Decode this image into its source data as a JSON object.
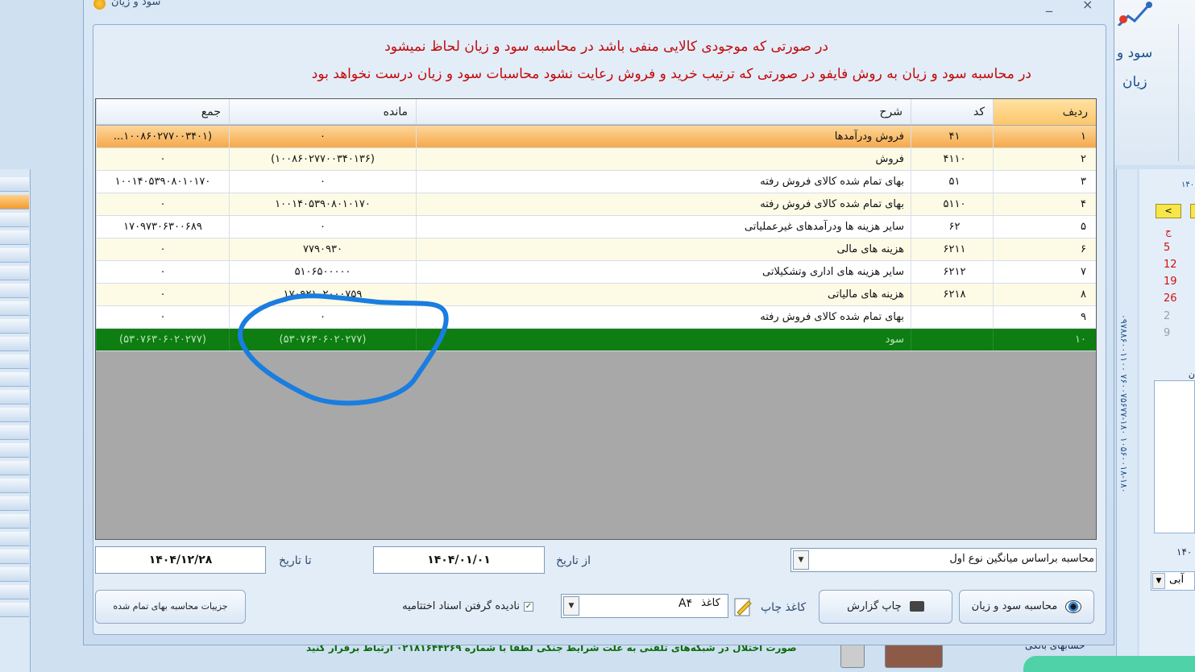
{
  "window": {
    "title": "سود و زیان",
    "minimize": "_",
    "close": "×"
  },
  "notices": [
    "در صورتی که موجودی کالایی منفی باشد در محاسبه سود و زیان لحاظ نمیشود",
    "در محاسبه سود و زیان به روش فایفو در صورتی که ترتیب خرید و فروش رعایت نشود محاسبات سود و زیان درست نخواهد بود"
  ],
  "grid": {
    "columns": [
      "ردیف",
      "کد",
      "شرح",
      "مانده",
      "جمع"
    ],
    "rows": [
      {
        "radif": "۱",
        "kod": "۴۱",
        "sharh": "فروش ودرآمدها",
        "mande": "۰",
        "jam": "(۱۰۰۸۶۰۲۷۷۰۰۳۴۰۱..."
      },
      {
        "radif": "۲",
        "kod": "۴۱۱۰",
        "sharh": "فروش",
        "mande": "(۱۰۰۸۶۰۲۷۷۰۰۳۴۰۱۳۶)",
        "jam": "۰"
      },
      {
        "radif": "۳",
        "kod": "۵۱",
        "sharh": "بهای تمام شده کالای فروش رفته",
        "mande": "۰",
        "jam": "۱۰۰۱۴۰۵۳۹۰۸۰۱۰۱۷۰"
      },
      {
        "radif": "۴",
        "kod": "۵۱۱۰",
        "sharh": "بهای تمام شده کالای فروش رفته",
        "mande": "۱۰۰۱۴۰۵۳۹۰۸۰۱۰۱۷۰",
        "jam": "۰"
      },
      {
        "radif": "۵",
        "kod": "۶۲",
        "sharh": "سایر هزینه ها ودرآمدهای غیرعملیاتی",
        "mande": "۰",
        "jam": "۱۷۰۹۷۳۰۶۳۰۰۶۸۹"
      },
      {
        "radif": "۶",
        "kod": "۶۲۱۱",
        "sharh": "هزینه های مالی",
        "mande": "۷۷۹۰۹۳۰",
        "jam": "۰"
      },
      {
        "radif": "۷",
        "kod": "۶۲۱۲",
        "sharh": "سایر هزینه های اداری وتشکیلاتی",
        "mande": "۵۱۰۶۵۰۰۰۰۰",
        "jam": "۰"
      },
      {
        "radif": "۸",
        "kod": "۶۲۱۸",
        "sharh": "هزینه های مالیاتی",
        "mande": "۱۷۰۹۲۱۰۲۰۰۰۷۵۹",
        "jam": "۰"
      },
      {
        "radif": "۹",
        "kod": "",
        "sharh": "بهای تمام شده کالای فروش رفته",
        "mande": "۰",
        "jam": "۰"
      },
      {
        "radif": "۱۰",
        "kod": "",
        "sharh": "سود",
        "mande": "(۵۳۰۷۶۳۰۶۰۲۰۲۷۷)",
        "jam": "(۵۳۰۷۶۳۰۶۰۲۰۲۷۷)"
      }
    ]
  },
  "filters": {
    "to_date_label": "تا تاریخ",
    "to_date": "۱۴۰۴/۱۲/۲۸",
    "from_date_label": "از تاریخ",
    "from_date": "۱۴۰۴/۰۱/۰۱",
    "method": "محاسبه براساس میانگین نوع اول"
  },
  "actions": {
    "details_button": "جزییات محاسبه بهای تمام شده",
    "ignore_closing_label": "نادیده گرفتن اسناد اختتامیه",
    "ignore_closing_checked": "✓",
    "paper_value": "A۴",
    "paper_label_1": "کاغذ",
    "paper_label_2": "کاغذ چاپ",
    "print_button": "چاپ گزارش",
    "calc_button": "محاسبه سود و زیان"
  },
  "background": {
    "ribbon_label_1": "سود و",
    "ribbon_label_2": "زیان",
    "vertical_phone": "۰۹۷۸۸۶۰۰۱۱۰۰ ۷۶۰۰۷۵۶۷۷-۱۸۰ ۱۰۵۶۰۰۱۸-۱۸۰",
    "calendar_year": "۱۴۰",
    "calendar_prev": "<",
    "calendar_header": "ج",
    "calendar_days": [
      "5",
      "12",
      "19",
      "26",
      "2",
      "9"
    ],
    "calendar_south": "ن جنوب",
    "calendar_year2": "۱۴۰",
    "color_combo": "آبی",
    "status_message": "صورت اختلال در شبکه‌های تلفنی به علت شرایط جنگی لطفا با شماره ۰۲۱۸۱۶۴۴۲۶۹ ارتباط برقرار کنید",
    "bank_label": "حسابهای بانکی"
  },
  "colors": {
    "notice": "#c30909",
    "total_row": "#0e7d12",
    "selected_row": "#f6a84a",
    "annotation": "#1a7de0"
  }
}
